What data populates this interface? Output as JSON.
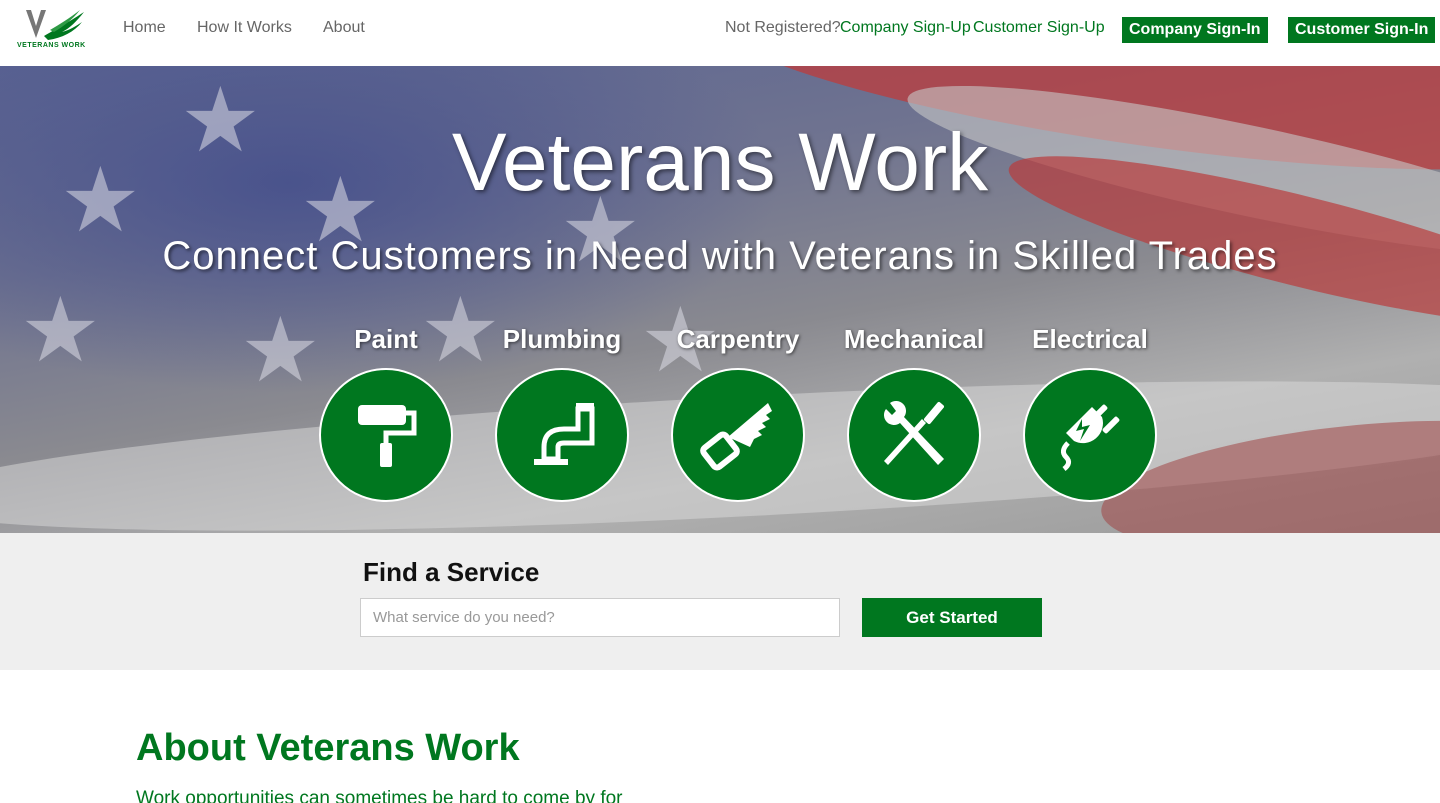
{
  "nav": {
    "logo_text": "VETERANS WORK",
    "links": [
      "Home",
      "How It Works",
      "About"
    ],
    "not_registered": "Not Registered?",
    "company_signup": "Company Sign-Up",
    "customer_signup": "Customer Sign-Up",
    "company_signin": "Company Sign-In",
    "customer_signin": "Customer Sign-In"
  },
  "hero": {
    "title": "Veterans Work",
    "subtitle": "Connect Customers in Need with Veterans in Skilled Trades",
    "services": [
      {
        "label": "Paint",
        "icon": "paint-roller-icon"
      },
      {
        "label": "Plumbing",
        "icon": "pipe-icon"
      },
      {
        "label": "Carpentry",
        "icon": "saw-icon"
      },
      {
        "label": "Mechanical",
        "icon": "wrench-screwdriver-icon"
      },
      {
        "label": "Electrical",
        "icon": "plug-icon"
      }
    ]
  },
  "find": {
    "title": "Find a Service",
    "placeholder": "What service do you need?",
    "button": "Get Started"
  },
  "about": {
    "title": "About Veterans Work",
    "text": "Work opportunities can sometimes be hard to come by for"
  },
  "colors": {
    "brand_green": "#00771f",
    "band_gray": "#efefef"
  }
}
